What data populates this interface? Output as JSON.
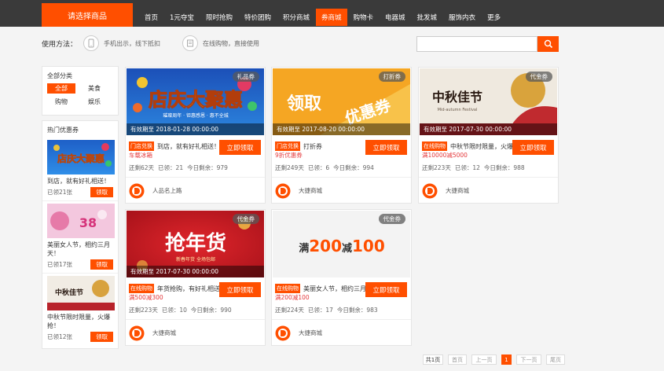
{
  "header": {
    "category_button": "请选择商品",
    "nav": [
      "首页",
      "1元夺宝",
      "限时抢购",
      "特价团购",
      "积分商城",
      "券商城",
      "购物卡",
      "电器城",
      "批发城",
      "服饰内衣",
      "更多"
    ],
    "active_nav": "券商城"
  },
  "usage": {
    "label": "使用方法：",
    "methods": [
      {
        "icon": "phone-icon",
        "text": "手机出示，线下抵扣"
      },
      {
        "icon": "cart-icon",
        "text": "在线购物，直接使用"
      }
    ]
  },
  "search": {
    "placeholder": "",
    "icon": "search-icon"
  },
  "sidebar": {
    "category_title": "全部分类",
    "categories": [
      "全部",
      "美食",
      "购物",
      "娱乐"
    ],
    "active_category": "全部",
    "hot_title": "热门优惠券",
    "hot": [
      {
        "image_text": "店庆大聚惠",
        "title": "到店，就有好礼相送！",
        "count": "已领21张",
        "button": "领取"
      },
      {
        "image_text": "38",
        "title": "美丽女人节，相约三月天！",
        "count": "已领17张",
        "button": "领取"
      },
      {
        "image_text": "中秋佳节",
        "title": "中秋节限时限量，火爆抢！",
        "count": "已领12张",
        "button": "领取"
      }
    ]
  },
  "coupons": [
    {
      "badge": "礼品券",
      "image_text": "店庆大聚惠",
      "image_sub": "璀璨周年 · 钜惠感恩 · 惠不全城",
      "validity": "有效期至 2018-01-28 00:00:00",
      "type": "门店兑换",
      "title": "到店，就有好礼相送！",
      "sub": "车载冰箱",
      "button": "立即领取",
      "stats": [
        "还剩62天",
        "已领：21",
        "今日剩余：979"
      ],
      "shop": "人品名上路"
    },
    {
      "badge": "打折券",
      "image_text": "领取",
      "image_text2": "优惠券",
      "validity": "有效期至 2017-08-20 00:00:00",
      "type": "门店兑换",
      "title": "打折券",
      "sub": "9折优惠券",
      "button": "立即领取",
      "stats": [
        "还剩249天",
        "已领：6",
        "今日剩余：994"
      ],
      "shop": "大捷商城"
    },
    {
      "badge": "代金券",
      "image_text": "中秋佳节",
      "image_sub": "Mid-autumn Festival",
      "validity": "有效期至 2017-07-30 00:00:00",
      "type": "在线购物",
      "title": "中秋节限时限量，火爆",
      "sub": "满10000减5000",
      "button": "立即领取",
      "stats": [
        "还剩223天",
        "已领：12",
        "今日剩余：988"
      ],
      "shop": "大捷商城"
    },
    {
      "badge": "代金券",
      "image_text": "抢年货",
      "image_sub": "新春年货 全场包邮",
      "validity": "有效期至 2017-07-30 00:00:00",
      "type": "在线购物",
      "title": "年货抢购，有好礼相送！",
      "sub": "满500减300",
      "button": "立即领取",
      "stats": [
        "还剩223天",
        "已领：10",
        "今日剩余：990"
      ],
      "shop": "大捷商城"
    },
    {
      "badge": "代金券",
      "image_prefix": "满",
      "image_amount1": "200",
      "image_mid": "减",
      "image_amount2": "100",
      "validity": "",
      "type": "在线购物",
      "title": "美丽女人节，相约三月",
      "sub": "满200减100",
      "button": "立即领取",
      "stats": [
        "还剩224天",
        "已领：17",
        "今日剩余：983"
      ],
      "shop": "大捷商城"
    }
  ],
  "pager": {
    "total": "共1页",
    "first": "首页",
    "prev": "上一页",
    "current": "1",
    "next": "下一页",
    "last": "尾页"
  },
  "colors": {
    "accent": "#ff4f00",
    "topbar": "#3a3a3a",
    "price": "#e4393c"
  }
}
